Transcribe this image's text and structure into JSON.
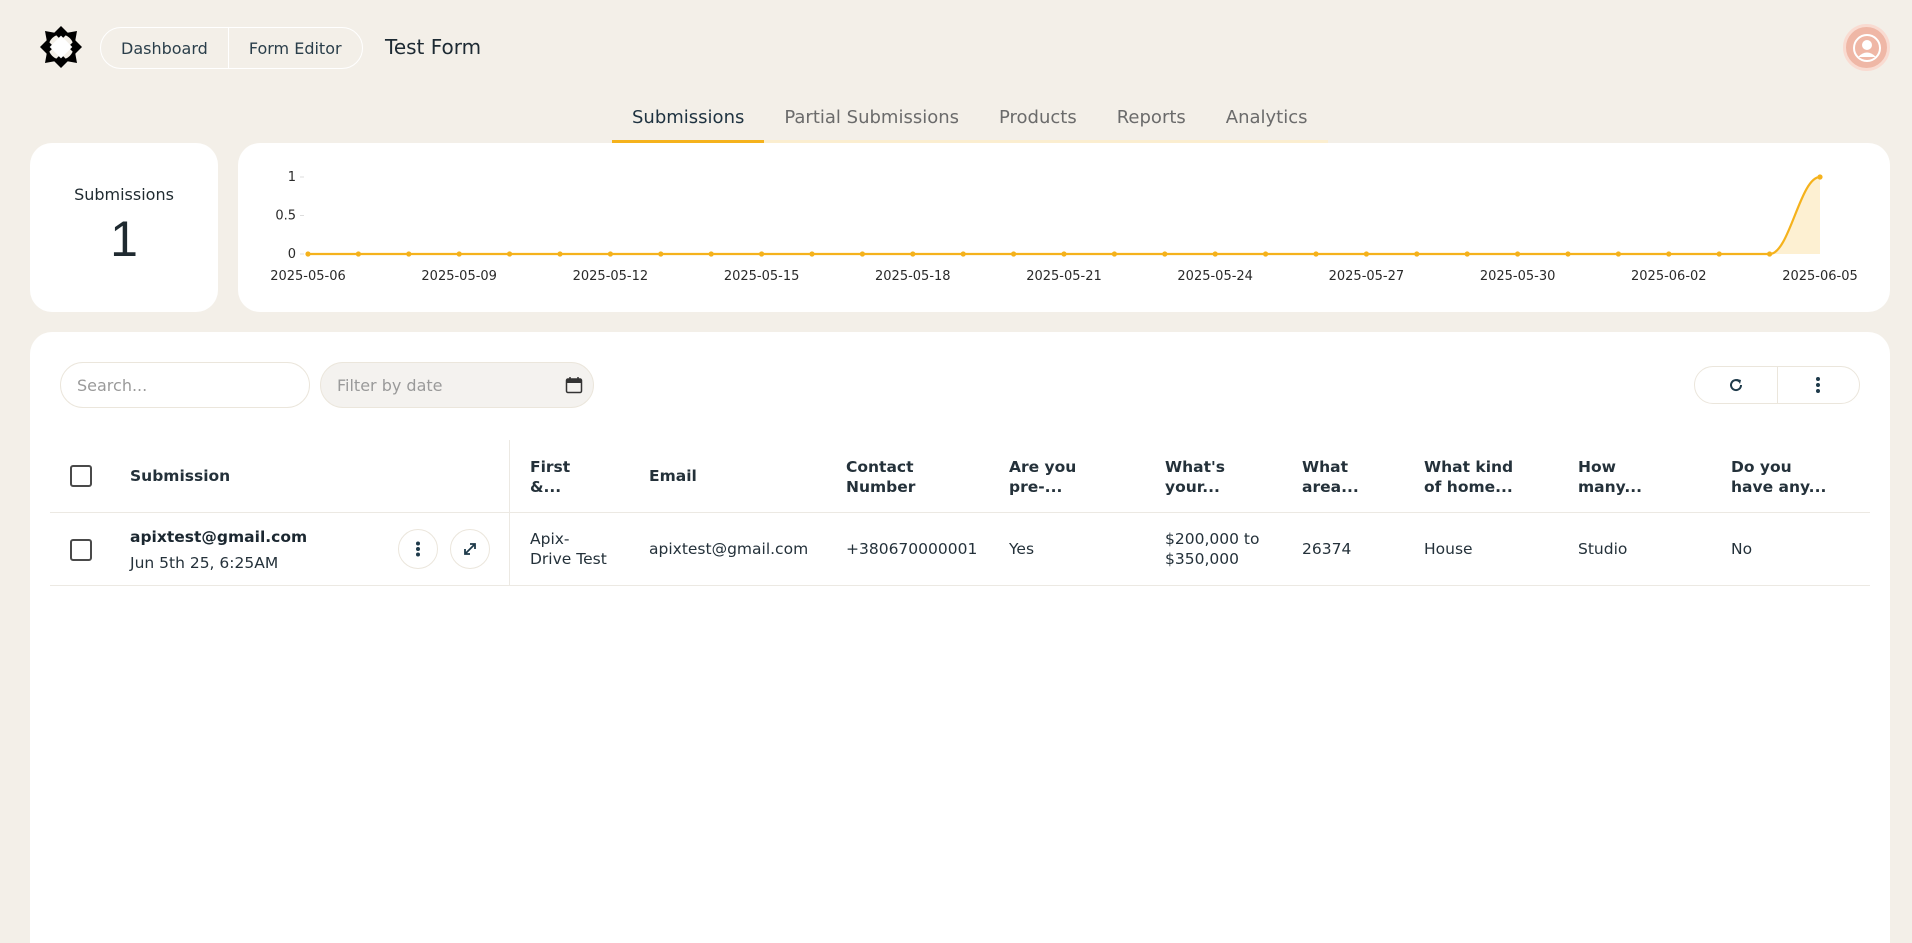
{
  "header": {
    "nav": [
      "Dashboard",
      "Form Editor"
    ],
    "title": "Test Form"
  },
  "tabs": [
    {
      "label": "Submissions",
      "active": true
    },
    {
      "label": "Partial Submissions",
      "active": false
    },
    {
      "label": "Products",
      "active": false
    },
    {
      "label": "Reports",
      "active": false
    },
    {
      "label": "Analytics",
      "active": false
    }
  ],
  "stat": {
    "label": "Submissions",
    "value": "1"
  },
  "chart_data": {
    "type": "area",
    "x": [
      "2025-05-06",
      "2025-05-07",
      "2025-05-08",
      "2025-05-09",
      "2025-05-10",
      "2025-05-11",
      "2025-05-12",
      "2025-05-13",
      "2025-05-14",
      "2025-05-15",
      "2025-05-16",
      "2025-05-17",
      "2025-05-18",
      "2025-05-19",
      "2025-05-20",
      "2025-05-21",
      "2025-05-22",
      "2025-05-23",
      "2025-05-24",
      "2025-05-25",
      "2025-05-26",
      "2025-05-27",
      "2025-05-28",
      "2025-05-29",
      "2025-05-30",
      "2025-05-31",
      "2025-06-01",
      "2025-06-02",
      "2025-06-03",
      "2025-06-04",
      "2025-06-05"
    ],
    "values": [
      0,
      0,
      0,
      0,
      0,
      0,
      0,
      0,
      0,
      0,
      0,
      0,
      0,
      0,
      0,
      0,
      0,
      0,
      0,
      0,
      0,
      0,
      0,
      0,
      0,
      0,
      0,
      0,
      0,
      0,
      1
    ],
    "x_tick_labels": [
      "2025-05-06",
      "2025-05-09",
      "2025-05-12",
      "2025-05-15",
      "2025-05-18",
      "2025-05-21",
      "2025-05-24",
      "2025-05-27",
      "2025-05-30",
      "2025-06-02",
      "2025-06-05"
    ],
    "y_ticks": [
      "0",
      "0.5",
      "1"
    ],
    "ylim": [
      0,
      1
    ],
    "color": "#f5b21c",
    "fill_color": "#fdf0d2",
    "grid": false
  },
  "toolbar": {
    "search_placeholder": "Search...",
    "date_placeholder": "Filter by date",
    "icons": [
      "calendar-icon",
      "refresh-icon",
      "more-vertical-icon"
    ]
  },
  "table": {
    "columns": [
      "Submission",
      "First\n&...",
      "Email",
      "Contact\nNumber",
      "Are you\npre-...",
      "What's\nyour...",
      "What\narea...",
      "What kind\nof home...",
      "How\nmany...",
      "Do you\nhave any..."
    ],
    "rows": [
      {
        "email": "apixtest@gmail.com",
        "date": "Jun 5th 25, 6:25AM",
        "cells": [
          "Apix-\nDrive Test",
          "apixtest@gmail.com",
          "+380670000001",
          "Yes",
          "$200,000 to\n$350,000",
          "26374",
          "House",
          "Studio",
          "No"
        ]
      }
    ]
  }
}
